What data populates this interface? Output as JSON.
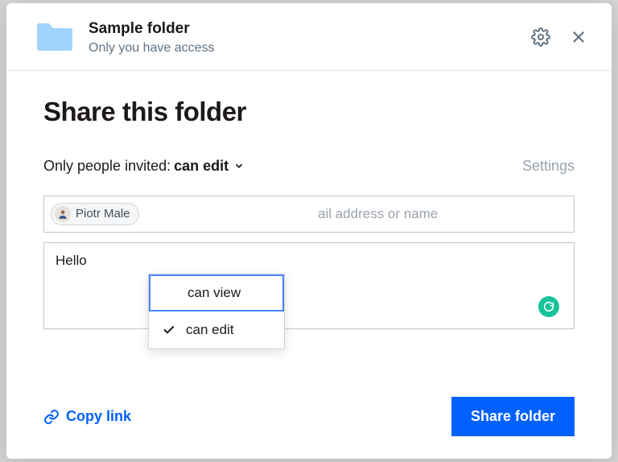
{
  "header": {
    "folder_title": "Sample folder",
    "access_text": "Only you have access"
  },
  "main": {
    "title": "Share this folder",
    "perm_prefix": "Only people invited:",
    "perm_selected": "can edit",
    "settings_label": "Settings",
    "invite_placeholder": "ail address or name",
    "chip_name": "Piotr Male",
    "dropdown": {
      "option_view": "can view",
      "option_edit": "can edit",
      "selected_index": 0,
      "checked_index": 1
    },
    "message_value": "Hello"
  },
  "footer": {
    "copy_link_label": "Copy link",
    "share_btn_label": "Share folder"
  },
  "colors": {
    "primary": "#0061fe",
    "folder": "#a1d3ff",
    "grammarly": "#15c39a"
  }
}
